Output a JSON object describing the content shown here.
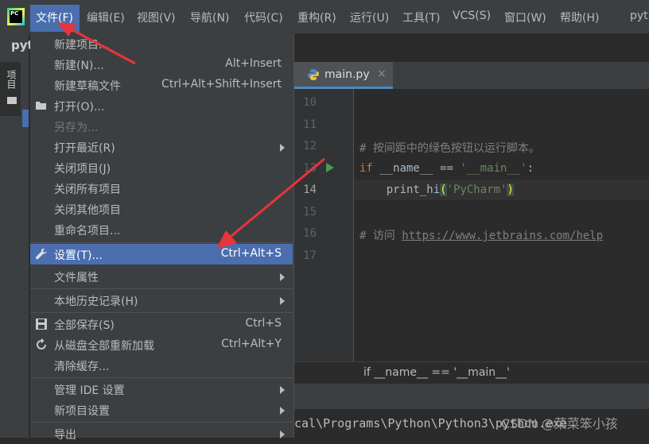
{
  "menubar": {
    "items": [
      "文件(F)",
      "编辑(E)",
      "视图(V)",
      "导航(N)",
      "代码(C)",
      "重构(R)",
      "运行(U)",
      "工具(T)",
      "VCS(S)",
      "窗口(W)",
      "帮助(H)"
    ],
    "window_title_partial": "pyt"
  },
  "left": {
    "project_title": "pyt",
    "side_tab_label": "项目"
  },
  "file_menu": {
    "items": [
      {
        "label": "新建项目...",
        "shortcut": ""
      },
      {
        "label": "新建(N)...",
        "shortcut": "Alt+Insert"
      },
      {
        "label": "新建草稿文件",
        "shortcut": "Ctrl+Alt+Shift+Insert"
      },
      {
        "label": "打开(O)...",
        "shortcut": ""
      },
      {
        "label": "另存为...",
        "shortcut": ""
      },
      {
        "label": "打开最近(R)",
        "shortcut": ""
      },
      {
        "label": "关闭项目(J)",
        "shortcut": ""
      },
      {
        "label": "关闭所有项目",
        "shortcut": ""
      },
      {
        "label": "关闭其他项目",
        "shortcut": ""
      },
      {
        "label": "重命名项目...",
        "shortcut": ""
      },
      {
        "label": "设置(T)...",
        "shortcut": "Ctrl+Alt+S"
      },
      {
        "label": "文件属性",
        "shortcut": ""
      },
      {
        "label": "本地历史记录(H)",
        "shortcut": ""
      },
      {
        "label": "全部保存(S)",
        "shortcut": "Ctrl+S"
      },
      {
        "label": "从磁盘全部重新加载",
        "shortcut": "Ctrl+Alt+Y"
      },
      {
        "label": "清除缓存...",
        "shortcut": ""
      },
      {
        "label": "管理 IDE 设置",
        "shortcut": ""
      },
      {
        "label": "新项目设置",
        "shortcut": ""
      },
      {
        "label": "导出",
        "shortcut": ""
      }
    ]
  },
  "editor": {
    "tab_label": "main.py",
    "line_numbers": [
      "10",
      "11",
      "12",
      "13",
      "14",
      "15",
      "16",
      "17"
    ],
    "code": {
      "line12_comment": "# 按间距中的绿色按钮以运行脚本。",
      "line13_if": "if",
      "line13_mid": " __name__ == ",
      "line13_str": "'__main__'",
      "line13_colon": ":",
      "line14_fn": "    print_hi",
      "line14_open": "(",
      "line14_str": "'PyCharm'",
      "line14_close": ")",
      "line16_comment": "# 访问 ",
      "line16_url": "https://www.jetbrains.com/help"
    },
    "breadcrumb": "if __name__ == '__main__'"
  },
  "bottom": {
    "terminal_text": "cal\\Programs\\Python\\Python3\\python.exe ",
    "watermark": "CSDN @菜菜笨小孩"
  },
  "colors": {
    "accent": "#4b6eaf",
    "annotation": "#e8343b"
  }
}
